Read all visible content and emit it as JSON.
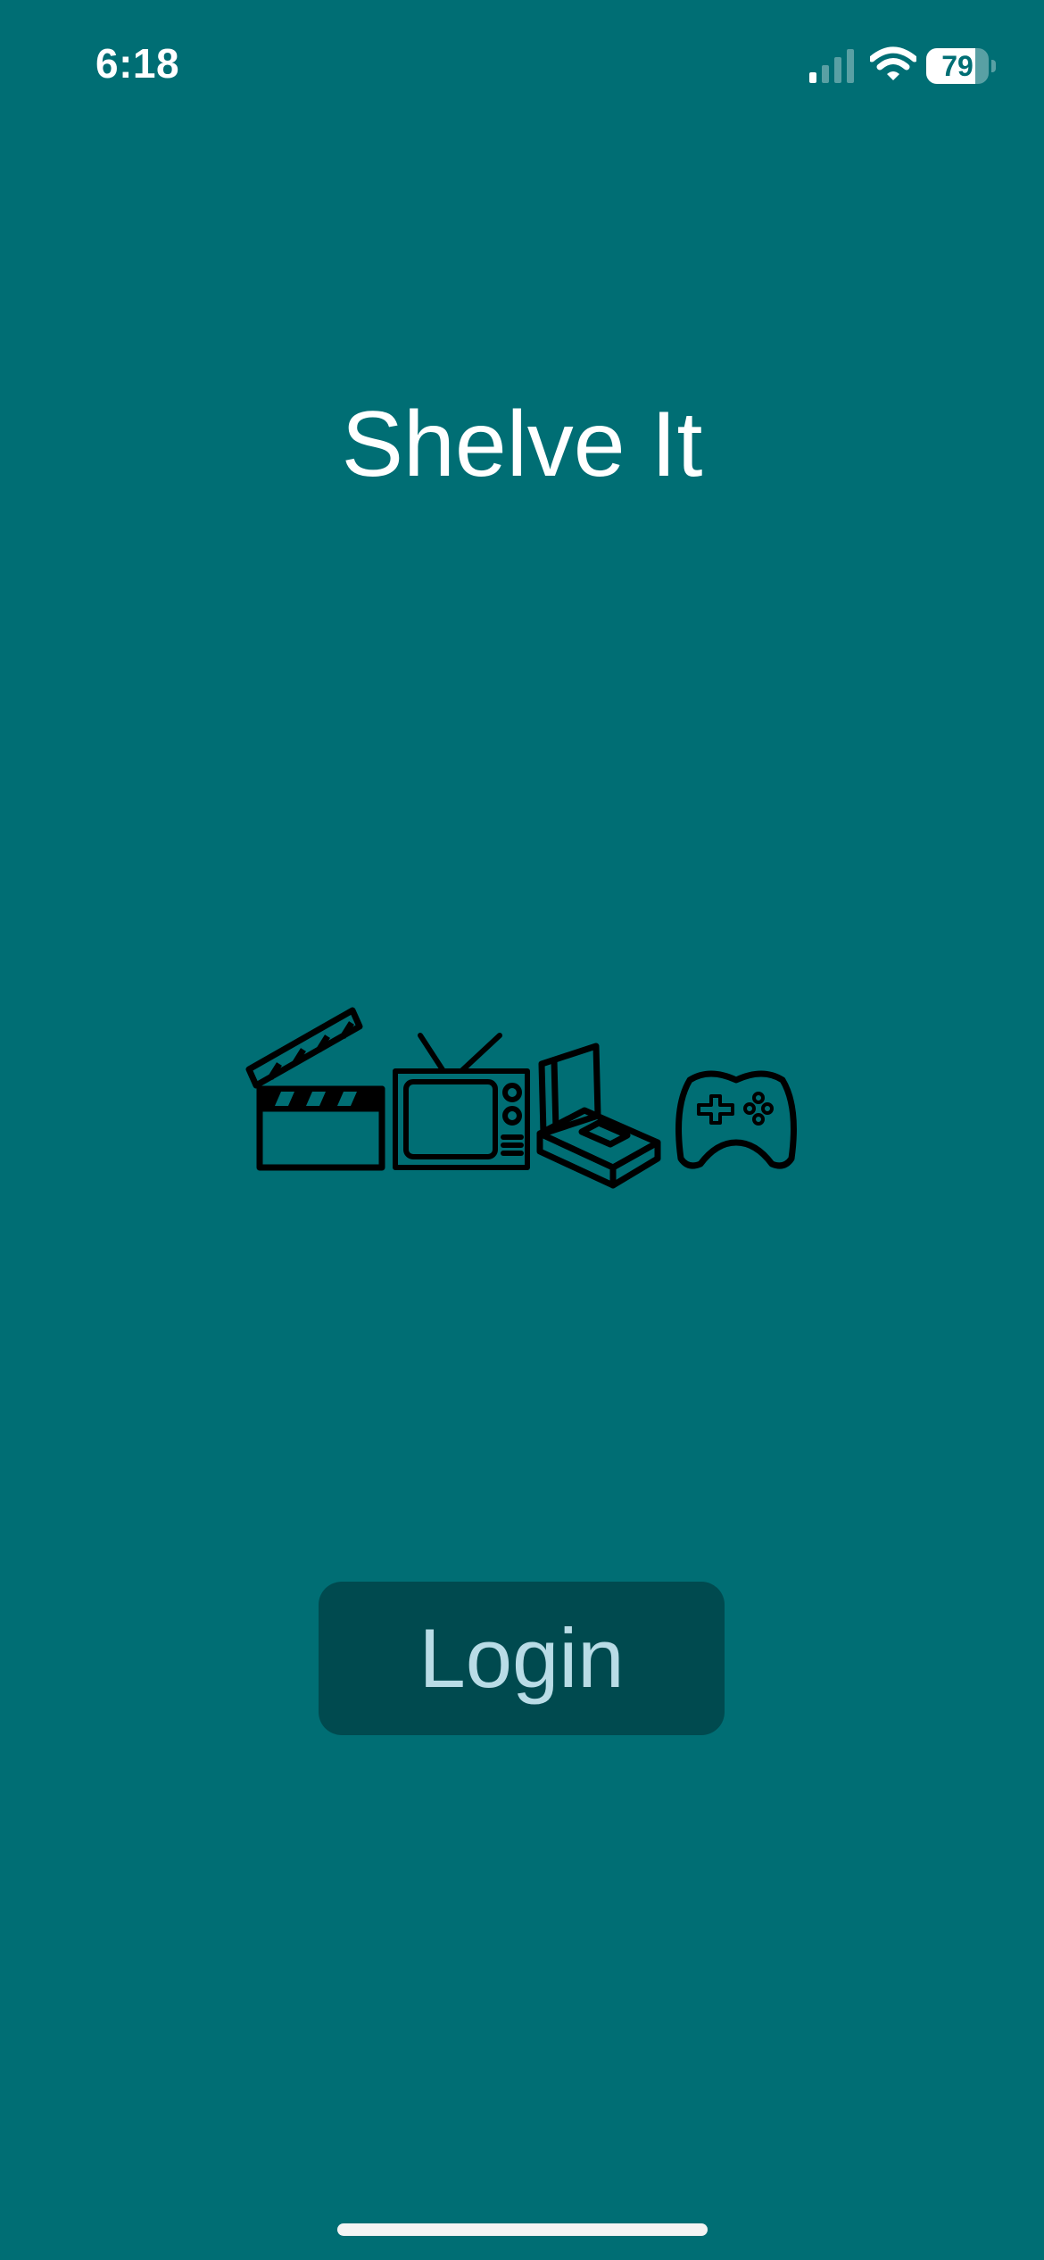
{
  "status_bar": {
    "time": "6:18",
    "battery_percent": "79",
    "battery_level": 0.79,
    "signal_bars_active": 1,
    "signal_bars_total": 4,
    "signal_icon": "cellular-signal-icon",
    "wifi_icon": "wifi-icon",
    "battery_icon": "battery-icon"
  },
  "app": {
    "title": "Shelve It"
  },
  "media_icons": [
    {
      "name": "clapperboard-icon"
    },
    {
      "name": "television-icon"
    },
    {
      "name": "books-icon"
    },
    {
      "name": "game-controller-icon"
    }
  ],
  "login_button": {
    "label": "Login"
  },
  "colors": {
    "background": "#006e74",
    "title_text": "#ffffff",
    "button_background": "#004a4f",
    "button_text": "#b9dce6",
    "icon_stroke": "#000000"
  }
}
